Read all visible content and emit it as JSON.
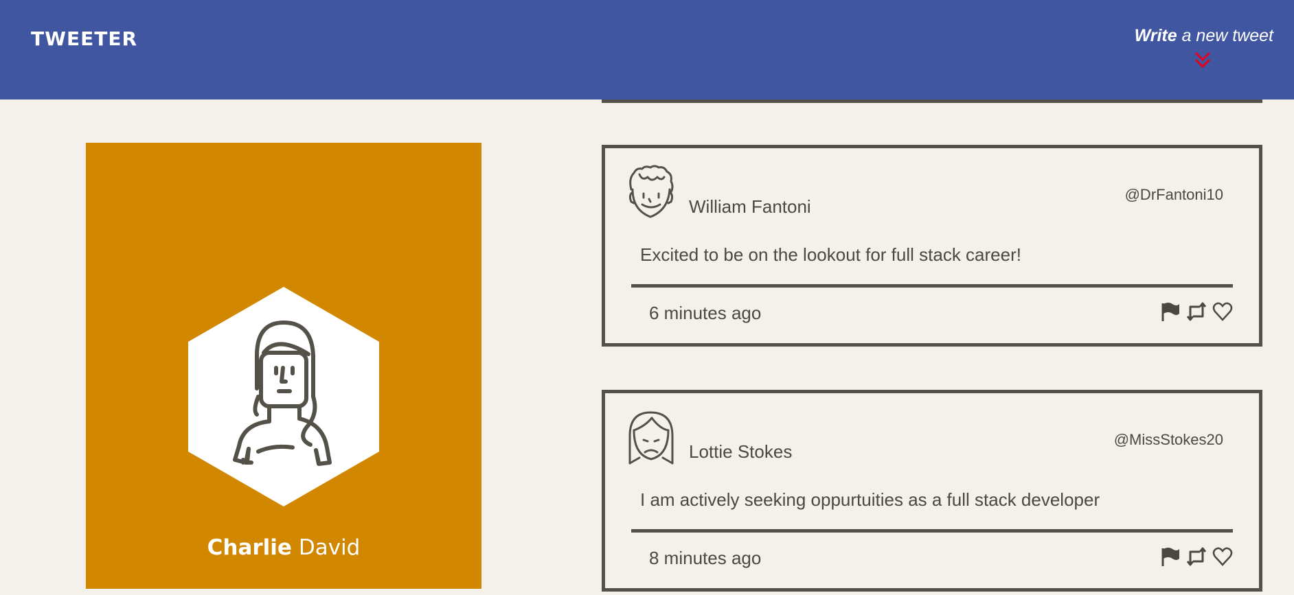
{
  "nav": {
    "brand": "TWEETER",
    "compose_bold": "Write",
    "compose_rest": " a new tweet",
    "compose_arrow_icon": "double-chevron-down-icon",
    "accent": "#e8001c",
    "bar_color": "#4056a1"
  },
  "profile": {
    "first_name": "Charlie",
    "last_name": " David",
    "avatar_icon": "woman-avatar-icon",
    "bg_color": "#d18800"
  },
  "tweets": [
    {
      "author": "William Fantoni",
      "handle": "@DrFantoni10",
      "content": "Excited to be on the lookout for full stack career!",
      "time": "6 minutes ago",
      "avatar_icon": "curly-hair-man-avatar-icon"
    },
    {
      "author": "Lottie Stokes",
      "handle": "@MissStokes20",
      "content": "I am actively seeking oppurtuities as a full stack developer",
      "time": "8 minutes ago",
      "avatar_icon": "woman-avatar-icon"
    }
  ],
  "action_icons": [
    "flag-icon",
    "retweet-icon",
    "heart-icon"
  ]
}
